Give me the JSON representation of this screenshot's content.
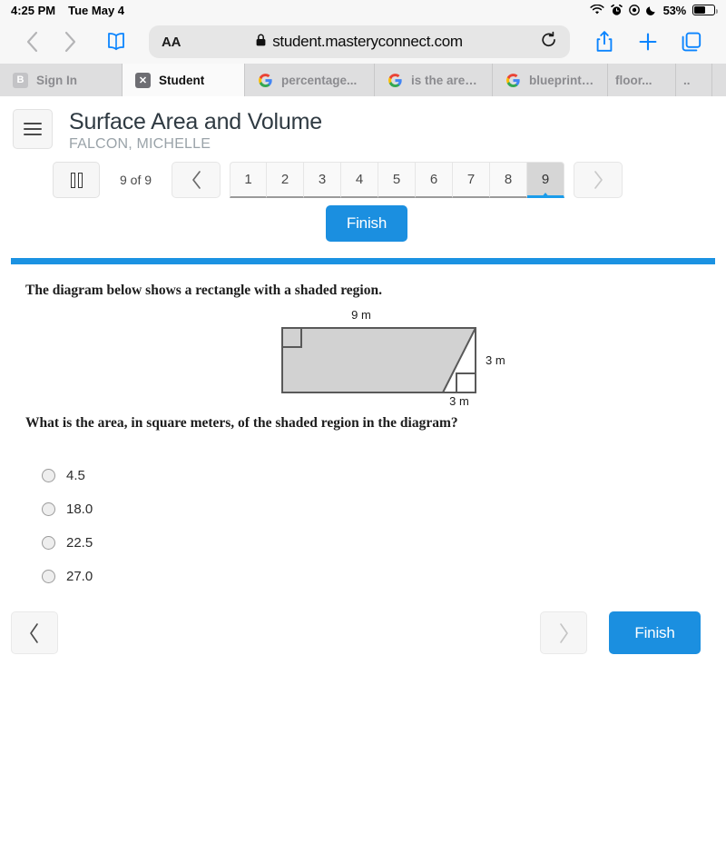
{
  "status_bar": {
    "time": "4:25 PM",
    "date": "Tue May 4",
    "battery_percent": "53%",
    "icons": [
      "wifi-icon",
      "alarm-icon",
      "location-icon",
      "moon-icon",
      "battery-icon"
    ]
  },
  "browser": {
    "url": "student.masteryconnect.com",
    "lock_icon": "lock-icon",
    "text_size_label": "AA",
    "toolbar_icons": [
      "back-chevron-icon",
      "forward-chevron-icon",
      "bookmarks-book-icon",
      "reload-icon",
      "share-icon",
      "new-tab-plus-icon",
      "tabs-overview-icon"
    ],
    "tabs": [
      {
        "label": "Sign In",
        "favicon": "bing-b-icon",
        "active": false
      },
      {
        "label": "Student",
        "favicon": "x-square-icon",
        "active": true
      },
      {
        "label": "percentage...",
        "favicon": "google-g-icon",
        "active": false
      },
      {
        "label": "is the area,...",
        "favicon": "google-g-icon",
        "active": false
      },
      {
        "label": "blueprint of...",
        "favicon": "google-g-icon",
        "active": false
      },
      {
        "label": "floor...",
        "favicon": "google-g-icon",
        "active": false
      },
      {
        "label": "..",
        "favicon": "",
        "active": false
      }
    ]
  },
  "assessment": {
    "title": "Surface Area and Volume",
    "student_name": "FALCON, MICHELLE",
    "menu_icon": "hamburger-menu-icon",
    "pause_icon": "pause-icon",
    "progress_text": "9 of 9",
    "prev_icon": "chevron-left-icon",
    "next_icon": "chevron-right-icon",
    "question_numbers": [
      "1",
      "2",
      "3",
      "4",
      "5",
      "6",
      "7",
      "8",
      "9"
    ],
    "current_question": "9",
    "finish_label": "Finish",
    "accent_color": "#1b92e2"
  },
  "question": {
    "stem": "The diagram below shows a rectangle with a shaded region.",
    "prompt": "What is the area, in square meters, of the shaded region in the diagram?",
    "figure": {
      "top_label": "9 m",
      "right_label": "3 m",
      "bottom_label": "3 m",
      "shade_color": "#d2d2d2",
      "stroke_color": "#595959",
      "description": "rectangle-with-shaded-trapezoid"
    },
    "choices": [
      {
        "label": "4.5",
        "selected": false
      },
      {
        "label": "18.0",
        "selected": false
      },
      {
        "label": "22.5",
        "selected": false
      },
      {
        "label": "27.0",
        "selected": false
      }
    ]
  },
  "bottom_nav": {
    "prev_icon": "chevron-left-icon",
    "next_icon": "chevron-right-icon",
    "finish_label": "Finish"
  }
}
